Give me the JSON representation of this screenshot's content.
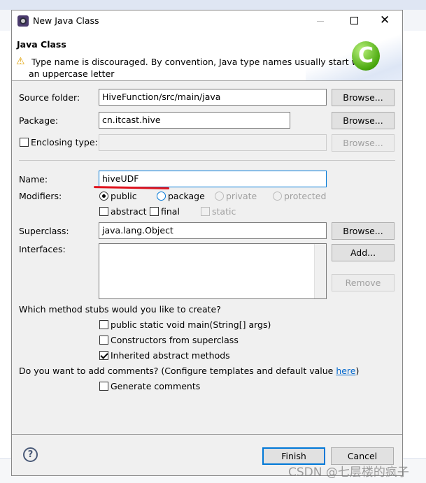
{
  "window": {
    "title": "New Java Class",
    "minimize_icon": "minimize-icon",
    "maximize_icon": "maximize-icon",
    "close_icon": "close-icon"
  },
  "header": {
    "title": "Java Class",
    "warning": "Type name is discouraged. By convention, Java type names usually start with",
    "warning_line2": "an uppercase letter",
    "logo": "C"
  },
  "form": {
    "source_folder": {
      "label": "Source folder:",
      "value": "HiveFunction/src/main/java",
      "button": "Browse..."
    },
    "package": {
      "label": "Package:",
      "value": "cn.itcast.hive",
      "button": "Browse..."
    },
    "enclosing": {
      "label": "Enclosing type:",
      "value": "",
      "button": "Browse...",
      "checked": false
    },
    "name": {
      "label": "Name:",
      "value": "hiveUDF"
    },
    "modifiers": {
      "label": "Modifiers:",
      "public": "public",
      "package": "package",
      "private": "private",
      "protected": "protected",
      "abstract": "abstract",
      "final": "final",
      "static": "static",
      "selected": "public"
    },
    "superclass": {
      "label": "Superclass:",
      "value": "java.lang.Object",
      "button": "Browse..."
    },
    "interfaces": {
      "label": "Interfaces:",
      "add": "Add...",
      "remove": "Remove"
    },
    "stubs": {
      "question": "Which method stubs would you like to create?",
      "main": "public static void main(String[] args)",
      "constructors": "Constructors from superclass",
      "inherited": "Inherited abstract methods",
      "main_checked": false,
      "constructors_checked": false,
      "inherited_checked": true
    },
    "comments": {
      "question": "Do you want to add comments? (Configure templates and default value ",
      "link": "here",
      "close": ")",
      "generate": "Generate comments",
      "checked": false
    }
  },
  "footer": {
    "finish": "Finish",
    "cancel": "Cancel",
    "help_icon": "help-icon"
  },
  "watermark": "CSDN @七层楼的疯子",
  "colors": {
    "accent": "#0078d7",
    "underline": "#e0141e",
    "link": "#0066cc"
  }
}
